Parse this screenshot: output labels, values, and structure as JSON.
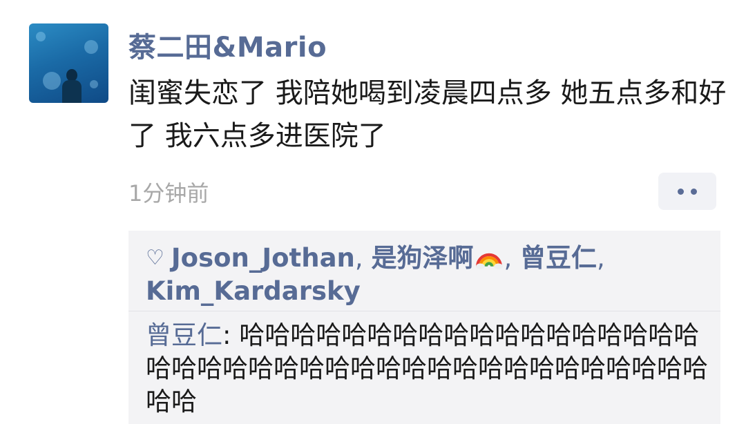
{
  "post": {
    "username": "蔡二田&Mario",
    "text": "闺蜜失恋了 我陪她喝到凌晨四点多 她五点多和好了 我六点多进医院了",
    "timestamp": "1分钟前",
    "more_icon": "more-dots-icon"
  },
  "likes": {
    "icon": "heart-outline-icon",
    "names": [
      "Joson_Jothan",
      "是狗泽啊",
      "曾豆仁",
      "Kim_Kardarsky"
    ],
    "separator": ", ",
    "emoji_after_name_2": "rainbow-icon"
  },
  "comment": {
    "author": "曾豆仁",
    "separator": ": ",
    "text": "哈哈哈哈哈哈哈哈哈哈哈哈哈哈哈哈哈哈哈哈哈哈哈哈哈哈哈哈哈哈哈哈哈哈哈哈哈哈哈哈哈哈"
  },
  "colors": {
    "name_link": "#576b95",
    "timestamp": "#a8a8a8",
    "interact_bg": "#f3f3f5"
  }
}
